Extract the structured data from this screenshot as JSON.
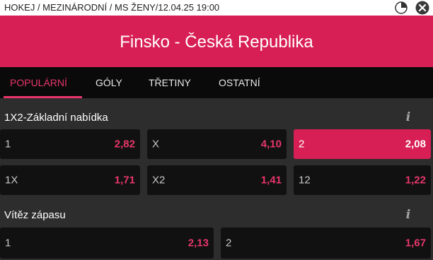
{
  "breadcrumb": "HOKEJ / MEZINÁRODNÍ / MS ŽENY/12.04.25 19:00",
  "icons": {
    "stats": "pie-chart-icon",
    "close": "close-icon"
  },
  "match_title": "Finsko - Česká Republika",
  "tabs": [
    "POPULÁRNÍ",
    "GÓLY",
    "TŘETINY",
    "OSTATNÍ"
  ],
  "active_tab": "POPULÁRNÍ",
  "colors": {
    "accent": "#d81f55",
    "odd_text": "#e8366a",
    "panel": "#111111",
    "background": "#2d2d2d"
  },
  "markets": [
    {
      "title": "1X2-Základní nabídka",
      "info": "i",
      "odds": [
        {
          "label": "1",
          "value": "2,82",
          "selected": false
        },
        {
          "label": "X",
          "value": "4,10",
          "selected": false
        },
        {
          "label": "2",
          "value": "2,08",
          "selected": true
        },
        {
          "label": "1X",
          "value": "1,71",
          "selected": false
        },
        {
          "label": "X2",
          "value": "1,41",
          "selected": false
        },
        {
          "label": "12",
          "value": "1,22",
          "selected": false
        }
      ]
    },
    {
      "title": "Vítěz zápasu",
      "info": "i",
      "odds": [
        {
          "label": "1",
          "value": "2,13",
          "selected": false
        },
        {
          "label": "2",
          "value": "1,67",
          "selected": false
        }
      ]
    }
  ]
}
